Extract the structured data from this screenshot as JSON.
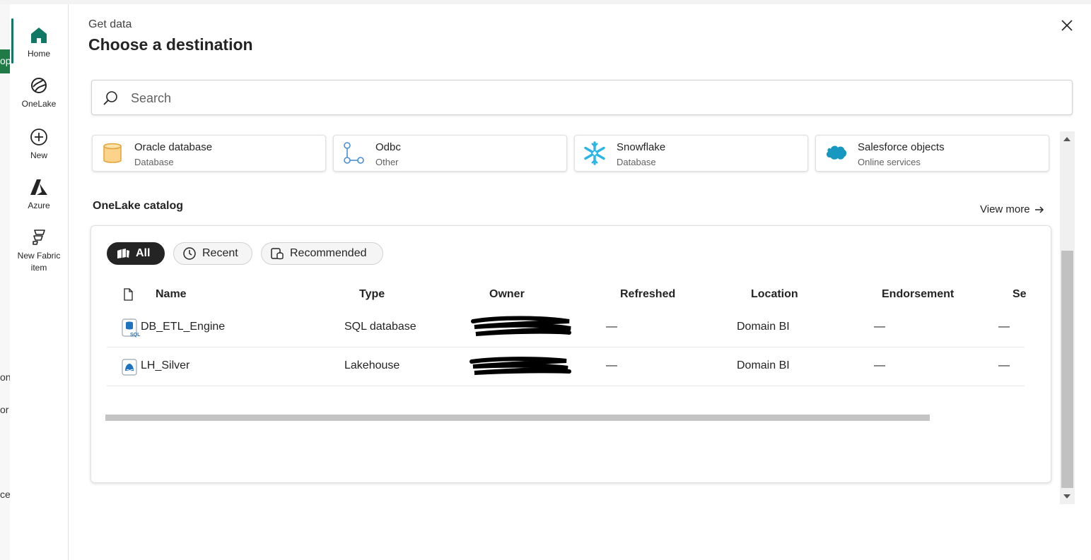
{
  "background_fragments": [
    "op",
    "on",
    "or",
    "ce"
  ],
  "dialog": {
    "subtitle": "Get data",
    "title": "Choose a destination"
  },
  "rail": [
    {
      "label": "Home",
      "icon": "home-icon"
    },
    {
      "label": "OneLake",
      "icon": "onelake-icon"
    },
    {
      "label": "New",
      "icon": "plus-circle-icon"
    },
    {
      "label": "Azure",
      "icon": "azure-icon"
    },
    {
      "label": "New Fabric item",
      "icon": "fabric-item-icon"
    }
  ],
  "search": {
    "placeholder": "Search"
  },
  "cards": [
    {
      "name": "Oracle database",
      "type": "Database",
      "icon": "oracle-database-icon"
    },
    {
      "name": "Odbc",
      "type": "Other",
      "icon": "odbc-icon"
    },
    {
      "name": "Snowflake",
      "type": "Database",
      "icon": "snowflake-icon"
    },
    {
      "name": "Salesforce objects",
      "type": "Online services",
      "icon": "salesforce-icon"
    }
  ],
  "catalog": {
    "title": "OneLake catalog",
    "view_more": "View more",
    "filters": [
      "All",
      "Recent",
      "Recommended"
    ],
    "columns": [
      "Name",
      "Type",
      "Owner",
      "Refreshed",
      "Location",
      "Endorsement",
      "Se"
    ],
    "rows": [
      {
        "name": "DB_ETL_Engine",
        "type": "SQL database",
        "refreshed": "—",
        "location": "Domain BI",
        "endorsement": "—",
        "se": "—",
        "icon": "sql-database-icon"
      },
      {
        "name": "LH_Silver",
        "type": "Lakehouse",
        "refreshed": "—",
        "location": "Domain BI",
        "endorsement": "—",
        "se": "—",
        "icon": "lakehouse-icon"
      }
    ]
  },
  "colors": {
    "accent": "#117865",
    "active_pill": "#242424",
    "oracle": "#f5b041",
    "snowflake": "#29b5e8",
    "salesforce": "#1798c1"
  }
}
